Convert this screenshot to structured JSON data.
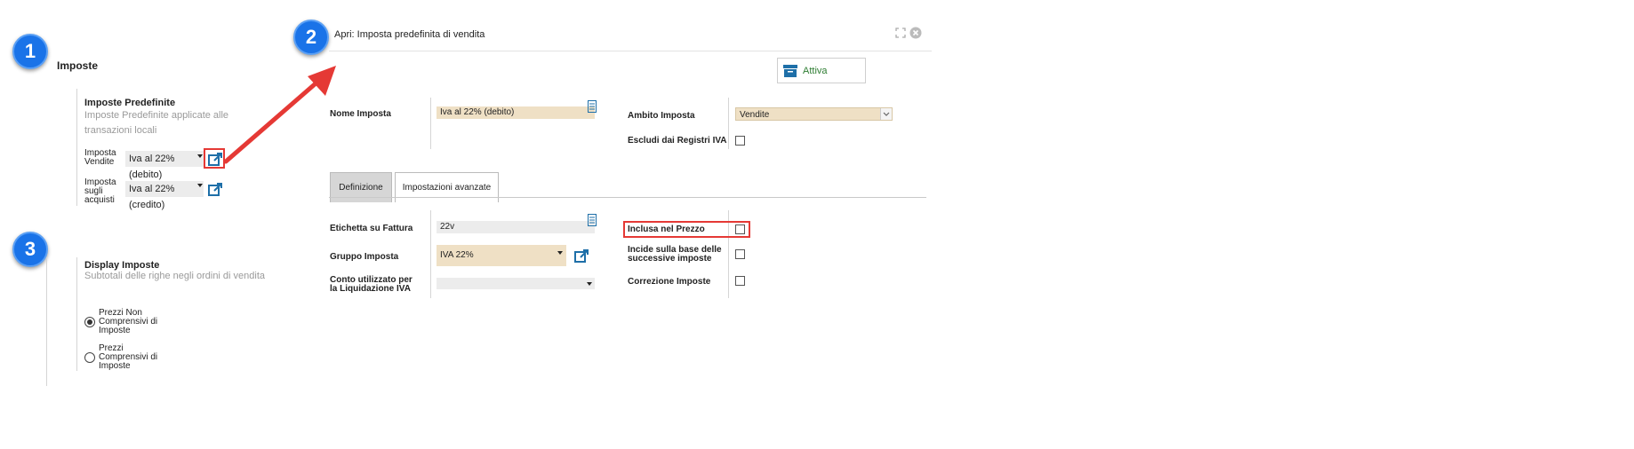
{
  "badges": [
    "1",
    "2",
    "3"
  ],
  "left": {
    "section_title": "Imposte",
    "predefined": {
      "title": "Imposte Predefinite",
      "subtitle": "Imposte Predefinite applicate alle transazioni locali",
      "sales_label": "Imposta Vendite",
      "sales_value": "Iva al 22% (debito)",
      "purchase_label": "Imposta sugli acquisti",
      "purchase_value": "Iva al 22% (credito)"
    },
    "display": {
      "title": "Display Imposte",
      "subtitle": "Subtotali delle righe negli ordini di vendita",
      "option_excluded": "Prezzi Non Comprensivi di Imposte",
      "option_included": "Prezzi Comprensivi di Imposte",
      "selected": "excluded"
    }
  },
  "dialog": {
    "title": "Apri: Imposta predefinita di vendita",
    "active_button": "Attiva",
    "fields": {
      "nome_label": "Nome Imposta",
      "nome_value": "Iva al 22% (debito)",
      "ambito_label": "Ambito Imposta",
      "ambito_value": "Vendite",
      "escludi_label": "Escludi dai Registri IVA"
    },
    "tabs": [
      "Definizione",
      "Impostazioni avanzate"
    ],
    "active_tab": "Definizione",
    "definizione": {
      "etichetta_label": "Etichetta su Fattura",
      "etichetta_value": "22v",
      "gruppo_label": "Gruppo Imposta",
      "gruppo_value": "IVA 22%",
      "conto_label": "Conto utilizzato per la Liquidazione IVA",
      "conto_value": "",
      "inclusa_label": "Inclusa nel Prezzo",
      "incide_label": "Incide sulla base delle successive imposte",
      "correzione_label": "Correzione Imposte"
    }
  },
  "colors": {
    "badge": "#1a73e8",
    "highlight": "#e53935",
    "field_tan": "#efe0c5",
    "link_icon": "#1e6fa8"
  }
}
